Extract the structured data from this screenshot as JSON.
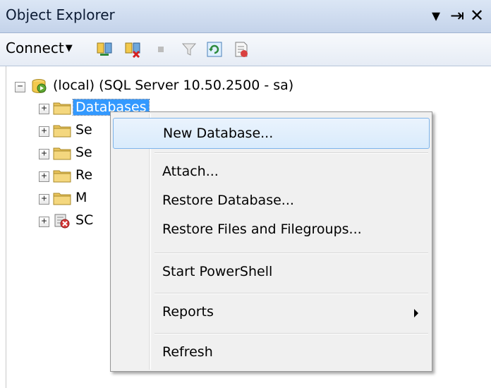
{
  "window": {
    "title": "Object Explorer",
    "pin_glyph": "▾ ⇤",
    "close_glyph": "✕"
  },
  "toolbar": {
    "connect_label": "Connect",
    "buttons": [
      {
        "icon": "connect-object-explorer-icon"
      },
      {
        "icon": "disconnect-icon"
      },
      {
        "icon": "stop-icon"
      },
      {
        "icon": "filter-icon"
      },
      {
        "icon": "refresh-icon"
      },
      {
        "icon": "new-query-script-icon"
      }
    ]
  },
  "tree": {
    "server": {
      "label": "(local) (SQL Server 10.50.2500 - sa)",
      "expander": "−"
    },
    "children": [
      {
        "label": "Databases",
        "expander": "+",
        "selected": true
      },
      {
        "label": "Se",
        "expander": "+"
      },
      {
        "label": "Se",
        "expander": "+"
      },
      {
        "label": "Re",
        "expander": "+"
      },
      {
        "label": "M",
        "expander": "+"
      },
      {
        "label": "SC",
        "expander": "+"
      }
    ]
  },
  "context_menu": {
    "items": [
      {
        "label": "New Database...",
        "highlighted": true
      },
      {
        "label": "Attach..."
      },
      {
        "label": "Restore Database..."
      },
      {
        "label": "Restore Files and Filegroups..."
      },
      {
        "label": "Start PowerShell"
      },
      {
        "label": "Reports",
        "has_submenu": true
      },
      {
        "label": "Refresh"
      }
    ]
  },
  "colors": {
    "selection": "#3399ff",
    "menu_highlight_border": "#7eb4ea",
    "folder": "#e8c25a",
    "server_green": "#5fa832"
  }
}
